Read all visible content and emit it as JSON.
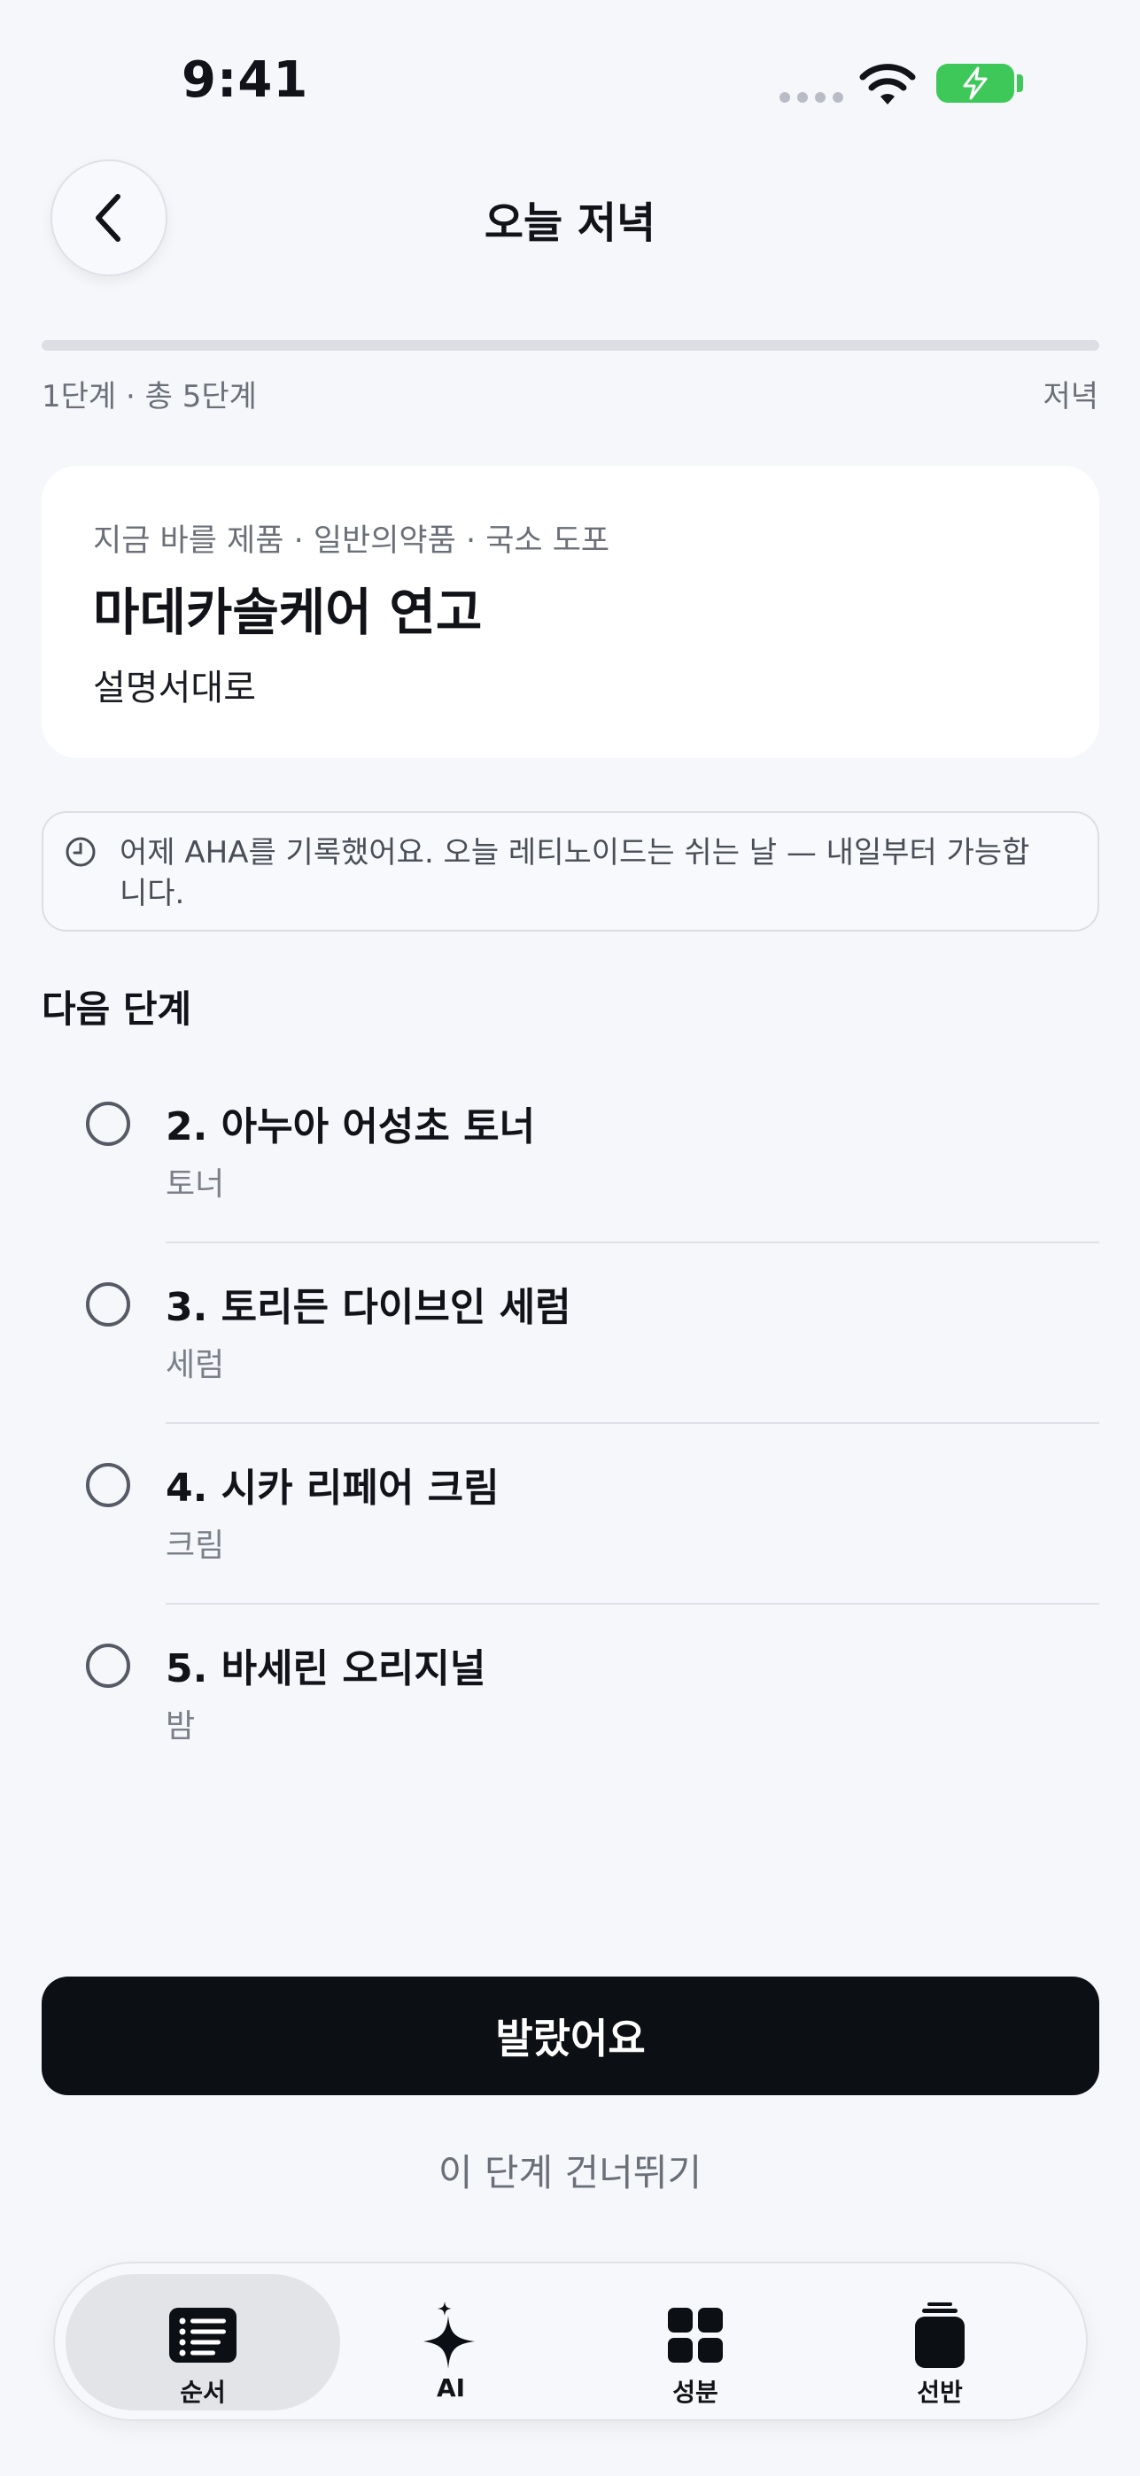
{
  "status_bar": {
    "time": "9:41"
  },
  "header": {
    "title": "오늘 저녁"
  },
  "progress": {
    "current": 1,
    "total": 5,
    "step_label": "1단계 · 총 5단계",
    "phase_label": "저녁"
  },
  "current_step": {
    "meta": "지금 바를 제품 · 일반의약품 · 국소 도포",
    "product": "마데카솔케어 연고",
    "instruction": "설명서대로"
  },
  "notice": {
    "icon": "clock-icon",
    "text": "어제 AHA를 기록했어요. 오늘 레티노이드는 쉬는 날 — 내일부터 가능합니다."
  },
  "next_steps": {
    "title": "다음 단계",
    "items": [
      {
        "name": "2. 아누아 어성초 토너",
        "type": "토너"
      },
      {
        "name": "3. 토리든 다이브인 세럼",
        "type": "세럼"
      },
      {
        "name": "4. 시카 리페어 크림",
        "type": "크림"
      },
      {
        "name": "5. 바세린 오리지널",
        "type": "밤"
      }
    ]
  },
  "actions": {
    "primary": "발랐어요",
    "skip": "이 단계 건너뛰기"
  },
  "tabbar": {
    "tabs": [
      {
        "label": "순서",
        "icon": "list-icon",
        "active": true
      },
      {
        "label": "AI",
        "icon": "sparkle-icon",
        "active": false
      },
      {
        "label": "성분",
        "icon": "grid-icon",
        "active": false
      },
      {
        "label": "선반",
        "icon": "jar-icon",
        "active": false
      }
    ]
  },
  "colors": {
    "background": "#f6f7fb",
    "primary": "#0c0f14",
    "battery": "#3ec85a",
    "muted": "#6b6f78"
  }
}
